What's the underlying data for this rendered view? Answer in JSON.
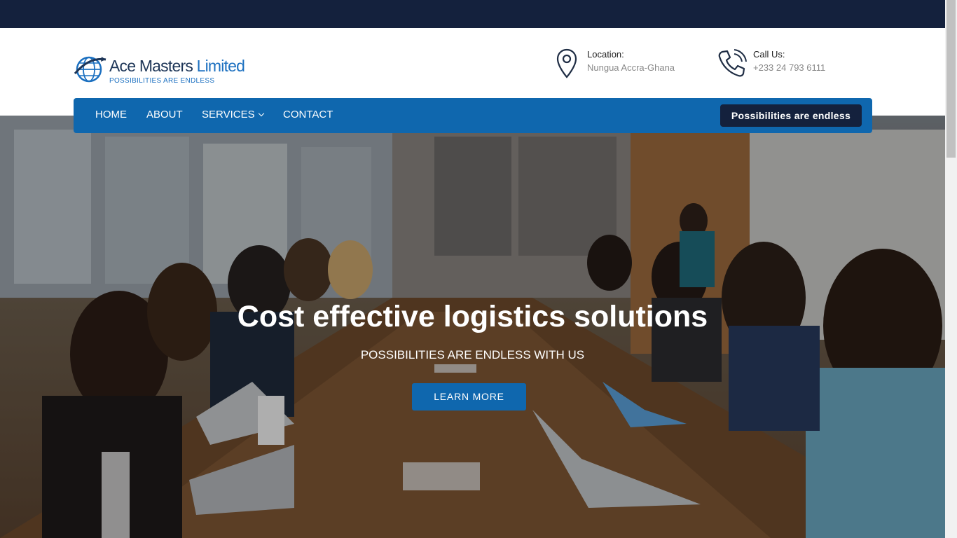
{
  "header": {
    "logo": {
      "name_main": "Ace Masters ",
      "name_accent": "Limited",
      "tagline": "POSSIBILITIES ARE ENDLESS",
      "icon": "globe-icon"
    },
    "location": {
      "icon": "map-pin-icon",
      "label": "Location:",
      "value": "Nungua Accra-Ghana"
    },
    "call": {
      "icon": "phone-icon",
      "label": "Call Us:",
      "value": "+233 24 793 6111"
    }
  },
  "nav": {
    "items": [
      {
        "label": "HOME"
      },
      {
        "label": "ABOUT"
      },
      {
        "label": "SERVICES",
        "icon": "chevron-down-icon"
      },
      {
        "label": "CONTACT"
      }
    ],
    "cta_label": "Possibilities are endless"
  },
  "hero": {
    "title": "Cost effective logistics solutions",
    "subtitle": "POSSIBILITIES ARE ENDLESS WITH US",
    "button_label": "LEARN MORE"
  },
  "colors": {
    "brand_blue": "#0f67ae",
    "navy": "#14213d",
    "white": "#ffffff"
  }
}
